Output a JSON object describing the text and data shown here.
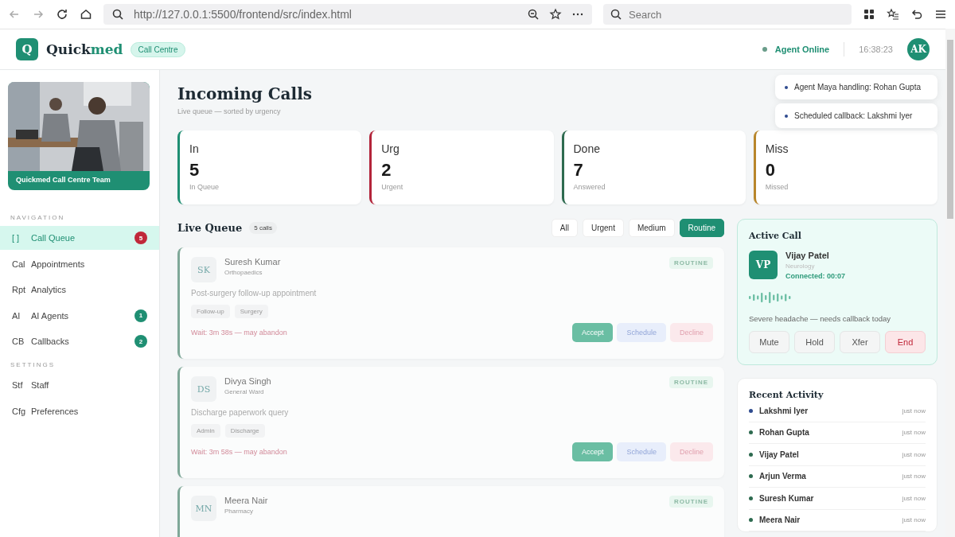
{
  "browser": {
    "url": "http://127.0.0.1:5500/frontend/src/index.html",
    "search_placeholder": "Search"
  },
  "header": {
    "logo_letter": "Q",
    "brand_first": "Quick",
    "brand_second": "med",
    "tag": "Call Centre",
    "status": "Agent Online",
    "clock": "16:38:23",
    "avatar": "AK"
  },
  "sidebar": {
    "photo_caption": "Quickmed Call Centre Team",
    "sections": [
      {
        "title": "NAVIGATION",
        "items": [
          {
            "icon_text": "[ ]",
            "label": "Call Queue",
            "selected": true,
            "badge": "5",
            "color": "#c0283a"
          },
          {
            "icon_text": "Cal",
            "label": "Appointments",
            "selected": false
          },
          {
            "icon_text": "Rpt",
            "label": "Analytics",
            "selected": false
          },
          {
            "icon_text": "AI",
            "label": "AI Agents",
            "selected": false,
            "badge": "1",
            "color": "#1f8f73"
          },
          {
            "icon_text": "CB",
            "label": "Callbacks",
            "selected": false,
            "badge": "2",
            "color": "#1f8f73"
          }
        ]
      },
      {
        "title": "SETTINGS",
        "items": [
          {
            "icon_text": "Stf",
            "label": "Staff",
            "selected": false
          },
          {
            "icon_text": "Cfg",
            "label": "Preferences",
            "selected": false
          }
        ]
      }
    ]
  },
  "toasts": [
    {
      "text": "Agent Maya handling: Rohan Gupta"
    },
    {
      "text": "Scheduled callback: Lakshmi Iyer"
    }
  ],
  "page": {
    "title": "Incoming Calls",
    "subtitle": "Live queue — sorted by urgency"
  },
  "stats": [
    {
      "label": "In",
      "value": "5",
      "caption": "In Queue",
      "color": "#1f8f73"
    },
    {
      "label": "Urg",
      "value": "2",
      "caption": "Urgent",
      "color": "#b3243a"
    },
    {
      "label": "Done",
      "value": "7",
      "caption": "Answered",
      "color": "#2d6a4f"
    },
    {
      "label": "Miss",
      "value": "0",
      "caption": "Missed",
      "color": "#b8862b"
    }
  ],
  "queue": {
    "title": "Live Queue",
    "count": "5 calls",
    "filters": [
      {
        "label": "All",
        "selected": false
      },
      {
        "label": "Urgent",
        "selected": false
      },
      {
        "label": "Medium",
        "selected": false
      },
      {
        "label": "Routine",
        "selected": true
      }
    ],
    "calls": [
      {
        "initials": "SK",
        "name": "Suresh Kumar",
        "dept": "Orthopaedics",
        "priority": "ROUTINE",
        "reason": "Post-surgery follow-up appointment",
        "tags": [
          "Follow-up",
          "Surgery"
        ],
        "wait": "Wait: 3m 38s — may abandon",
        "actions": [
          {
            "label": "Accept",
            "kind": "accept"
          },
          {
            "label": "Schedule",
            "kind": "schedule"
          },
          {
            "label": "Decline",
            "kind": "decline"
          }
        ]
      },
      {
        "initials": "DS",
        "name": "Divya Singh",
        "dept": "General Ward",
        "priority": "ROUTINE",
        "reason": "Discharge paperwork query",
        "tags": [
          "Admin",
          "Discharge"
        ],
        "wait": "Wait: 3m 58s — may abandon",
        "actions": [
          {
            "label": "Accept",
            "kind": "accept"
          },
          {
            "label": "Schedule",
            "kind": "schedule"
          },
          {
            "label": "Decline",
            "kind": "decline"
          }
        ]
      },
      {
        "initials": "MN",
        "name": "Meera Nair",
        "dept": "Pharmacy",
        "priority": "ROUTINE"
      }
    ]
  },
  "active_call": {
    "title": "Active Call",
    "initials": "VP",
    "name": "Vijay Patel",
    "dept": "Neurology",
    "status": "Connected: 00:07",
    "note": "Severe headache — needs callback today",
    "buttons": [
      {
        "label": "Mute",
        "kind": "plain"
      },
      {
        "label": "Hold",
        "kind": "plain"
      },
      {
        "label": "Xfer",
        "kind": "plain"
      },
      {
        "label": "End",
        "kind": "end"
      }
    ]
  },
  "activity": {
    "title": "Recent Activity",
    "items": [
      {
        "name": "Lakshmi Iyer",
        "time": "just now",
        "color": "#2f4b8f"
      },
      {
        "name": "Rohan Gupta",
        "time": "just now",
        "color": "#2d6a4f"
      },
      {
        "name": "Vijay Patel",
        "time": "just now",
        "color": "#2d6a4f"
      },
      {
        "name": "Arjun Verma",
        "time": "just now",
        "color": "#2d6a4f"
      },
      {
        "name": "Suresh Kumar",
        "time": "just now",
        "color": "#2d6a4f"
      },
      {
        "name": "Meera Nair",
        "time": "just now",
        "color": "#2d6a4f"
      }
    ]
  }
}
